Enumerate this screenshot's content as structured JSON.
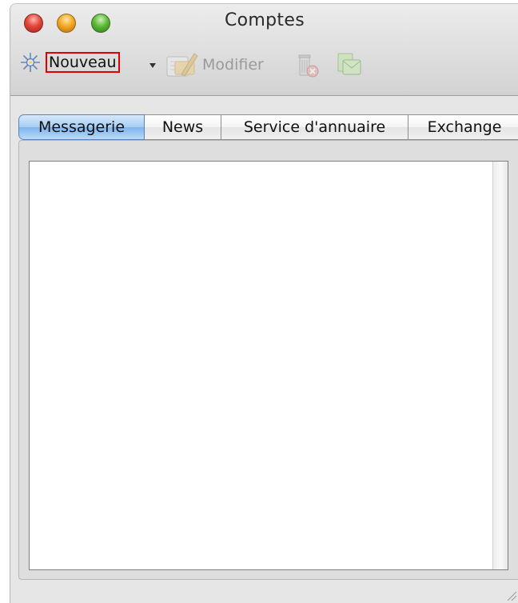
{
  "window": {
    "title": "Comptes"
  },
  "toolbar": {
    "new_label": "Nouveau",
    "new_icon": "sparkle-star-icon",
    "new_menu_icon": "dropdown-arrow-icon",
    "edit_label": "Modifier",
    "edit_icon": "edit-pencil-icon",
    "delete_icon": "trash-icon",
    "default_icon": "mail-account-icon"
  },
  "tabs": [
    {
      "label": "Messagerie",
      "active": true
    },
    {
      "label": "News",
      "active": false
    },
    {
      "label": "Service d'annuaire",
      "active": false
    },
    {
      "label": "Exchange",
      "active": false
    }
  ],
  "accounts_list": {
    "items": []
  },
  "colors": {
    "active_tab": "#8fbff0",
    "highlight_border": "#e00000",
    "traffic_close": "#e2463a",
    "traffic_minimize": "#f4a927",
    "traffic_zoom": "#5cba3b"
  }
}
